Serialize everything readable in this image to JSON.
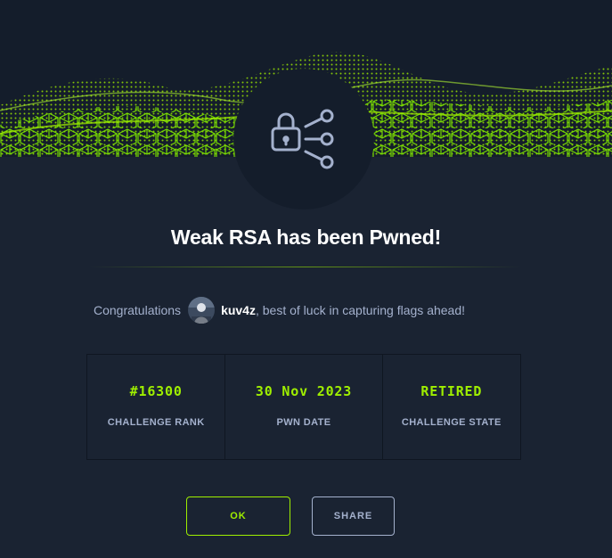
{
  "dialog": {
    "title": "Weak RSA has been Pwned!",
    "congrats_prefix": "Congratulations",
    "username": "kuv4z",
    "congrats_suffix": ", best of luck in capturing flags ahead!"
  },
  "stats": [
    {
      "value": "#16300",
      "label": "CHALLENGE RANK"
    },
    {
      "value": "30 Nov 2023",
      "label": "PWN DATE"
    },
    {
      "value": "RETIRED",
      "label": "CHALLENGE STATE"
    }
  ],
  "buttons": {
    "ok": "OK",
    "share": "SHARE"
  },
  "icons": {
    "badge": "crypto-lock-icon",
    "banner": "green-wave-grid"
  },
  "colors": {
    "background": "#1a2332",
    "panel": "#141d2b",
    "accent": "#9fef00",
    "muted_text": "#a4b1cd",
    "title": "#ffffff"
  }
}
